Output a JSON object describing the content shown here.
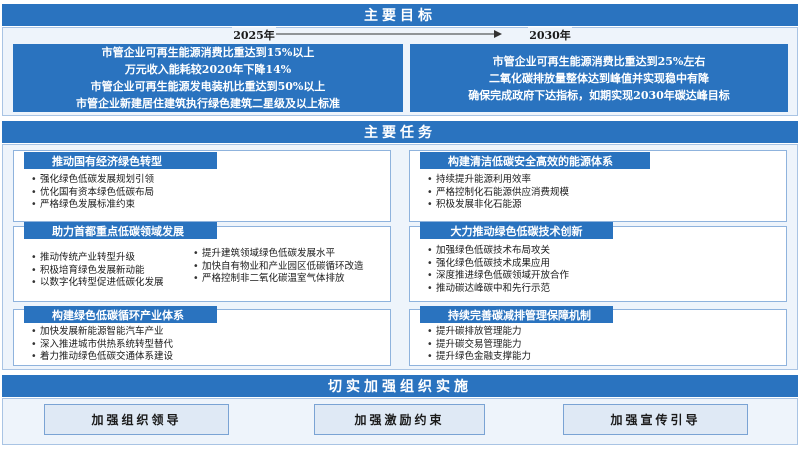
{
  "goals": {
    "title": "主要目标",
    "year_2025": "2025年",
    "year_2030": "2030年",
    "goals_2025": [
      "市管企业可再生能源消费比重达到15%以上",
      "万元收入能耗较2020年下降14%",
      "市管企业可再生能源发电装机比重达到50%以上",
      "市管企业新建居住建筑执行绿色建筑二星级及以上标准"
    ],
    "goals_2030": [
      "市管企业可再生能源消费比重达到25%左右",
      "二氧化碳排放量整体达到峰值并实现稳中有降",
      "确保完成政府下达指标，如期实现2030年碳达峰目标"
    ]
  },
  "tasks": {
    "title": "主要任务",
    "t1": {
      "title": "推动国有经济绿色转型",
      "items": [
        "强化绿色低碳发展规划引领",
        "优化国有资本绿色低碳布局",
        "严格绿色发展标准约束"
      ]
    },
    "t2": {
      "title": "构建清洁低碳安全高效的能源体系",
      "items": [
        "持续提升能源利用效率",
        "严格控制化石能源供应消费规模",
        "积极发展非化石能源"
      ]
    },
    "t3": {
      "title": "助力首都重点低碳领域发展",
      "items_left": [
        "推动传统产业转型升级",
        "积极培育绿色发展新动能",
        "以数字化转型促进低碳化发展"
      ],
      "items_right": [
        "提升建筑领域绿色低碳发展水平",
        "加快自有物业和产业园区低碳循环改造",
        "严格控制非二氧化碳温室气体排放"
      ]
    },
    "t4": {
      "title": "大力推动绿色低碳技术创新",
      "items": [
        "加强绿色低碳技术布局攻关",
        "强化绿色低碳技术成果应用",
        "深度推进绿色低碳领域开放合作",
        "推动碳达峰碳中和先行示范"
      ]
    },
    "t5": {
      "title": "构建绿色低碳循环产业体系",
      "items": [
        "加快发展新能源智能汽车产业",
        "深入推进城市供热系统转型替代",
        "着力推动绿色低碳交通体系建设"
      ]
    },
    "t6": {
      "title": "持续完善碳减排管理保障机制",
      "items": [
        "提升碳排放管理能力",
        "提升碳交易管理能力",
        "提升绿色金融支撑能力"
      ]
    }
  },
  "organization": {
    "title": "切实加强组织实施",
    "buttons": [
      "加强组织领导",
      "加强激励约束",
      "加强宣传引导"
    ]
  },
  "colors": {
    "primary_blue": "#2a73bf",
    "panel_bg": "#eef4fb",
    "border": "#8fb3dd"
  }
}
